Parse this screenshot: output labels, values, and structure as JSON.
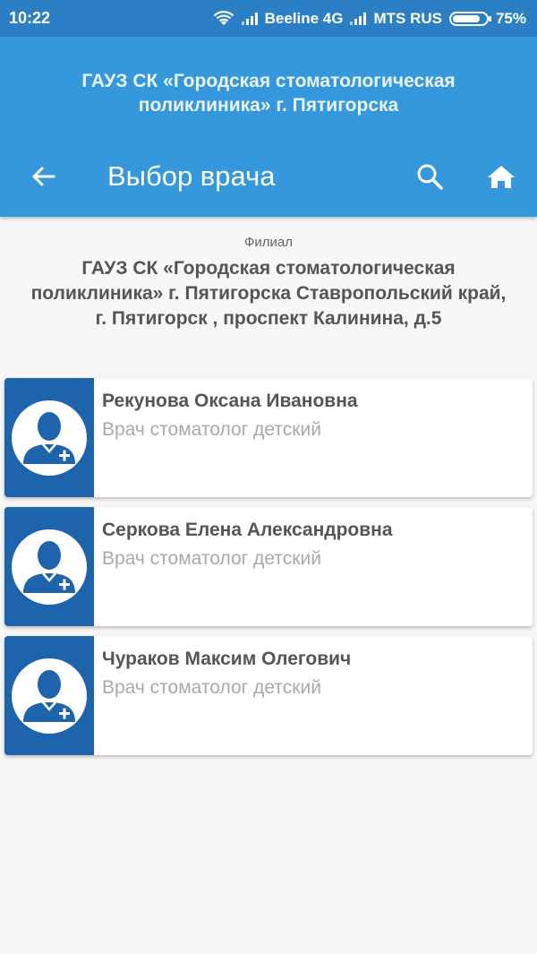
{
  "status_bar": {
    "time": "10:22",
    "carrier1": "Beeline 4G",
    "carrier2": "MTS RUS",
    "battery": "75%",
    "battery_level": 0.75
  },
  "header": {
    "organization": "ГАУЗ СК «Городская стоматологическая поликлиника» г. Пятигорска",
    "title": "Выбор врача",
    "icons": [
      "arrow-left-icon",
      "search-icon",
      "home-icon"
    ],
    "color": "#3597dc"
  },
  "branch": {
    "label": "Филиал",
    "name": "ГАУЗ СК «Городская стоматологическая поликлиника» г. Пятигорска Ставропольский край, г. Пятигорск , проспект Калинина, д.5"
  },
  "doctors": [
    {
      "name": "Рекунова Оксана Ивановна",
      "role": "Врач стоматолог детский"
    },
    {
      "name": "Серкова Елена Александровна",
      "role": "Врач стоматолог детский"
    },
    {
      "name": "Чураков Максим Олегович",
      "role": "Врач стоматолог детский"
    }
  ],
  "colors": {
    "avatar_panel": "#1d64ad",
    "status_bar": "#2a7fc5"
  }
}
